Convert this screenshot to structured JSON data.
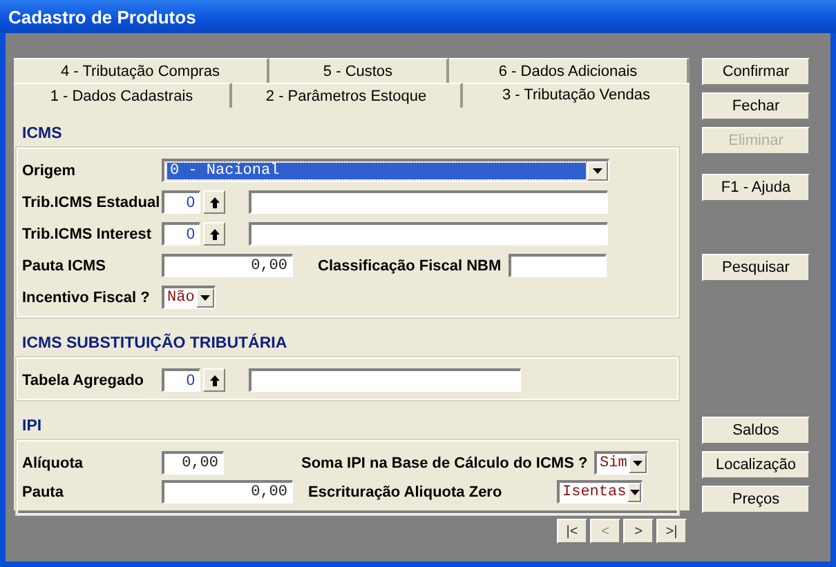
{
  "window": {
    "title": "Cadastro de Produtos"
  },
  "tab_rows": [
    [
      {
        "label": "4 - Tributação Compras",
        "selected": false
      },
      {
        "label": "5 - Custos",
        "selected": false
      },
      {
        "label": "6 - Dados Adicionais",
        "selected": false
      }
    ],
    [
      {
        "label": "1 - Dados Cadastrais",
        "selected": false
      },
      {
        "label": "2 - Parâmetros Estoque",
        "selected": false
      },
      {
        "label": "3 - Tributação Vendas",
        "selected": true
      }
    ]
  ],
  "icms": {
    "title": "ICMS",
    "origem": {
      "label": "Origem",
      "value": "0 - Nacional",
      "highlighted": true
    },
    "trib_estadual": {
      "label": "Trib.ICMS Estadual",
      "code": "0"
    },
    "trib_interest": {
      "label": "Trib.ICMS Interest",
      "code": "0"
    },
    "pauta": {
      "label": "Pauta ICMS",
      "value": "0,00"
    },
    "ncm": {
      "label": "Classificação Fiscal NBM"
    },
    "incentivo": {
      "label": "Incentivo Fiscal ?",
      "value": "Não",
      "highlighted": false
    }
  },
  "icms_st": {
    "title": "ICMS SUBSTITUIÇÃO TRIBUTÁRIA",
    "tabela": {
      "label": "Tabela Agregado",
      "code": "0"
    }
  },
  "ipi": {
    "title": "IPI",
    "aliquota": {
      "label": "Alíquota",
      "value": "0,00"
    },
    "soma": {
      "label": "Soma IPI na Base de Cálculo do ICMS ?",
      "value": "Sim",
      "highlighted": false
    },
    "pauta": {
      "label": "Pauta",
      "value": "0,00"
    },
    "escrituracao": {
      "label": "Escrituração Aliquota Zero",
      "value": "Isentas",
      "highlighted": false
    }
  },
  "button_groups": [
    [
      {
        "label": "Confirmar",
        "disabled": false
      },
      {
        "label": "Fechar",
        "disabled": false
      },
      {
        "label": "Eliminar",
        "disabled": true
      }
    ],
    [
      {
        "label": "F1 - Ajuda",
        "disabled": false
      }
    ],
    [
      {
        "label": "Pesquisar",
        "disabled": false
      }
    ],
    [
      {
        "label": "Saldos",
        "disabled": false
      },
      {
        "label": "Localização",
        "disabled": false
      },
      {
        "label": "Preços",
        "disabled": false
      }
    ]
  ],
  "navigator": [
    {
      "label": "|<",
      "disabled": false
    },
    {
      "label": "<",
      "disabled": true
    },
    {
      "label": ">",
      "disabled": false
    },
    {
      "label": ">|",
      "disabled": false
    }
  ]
}
